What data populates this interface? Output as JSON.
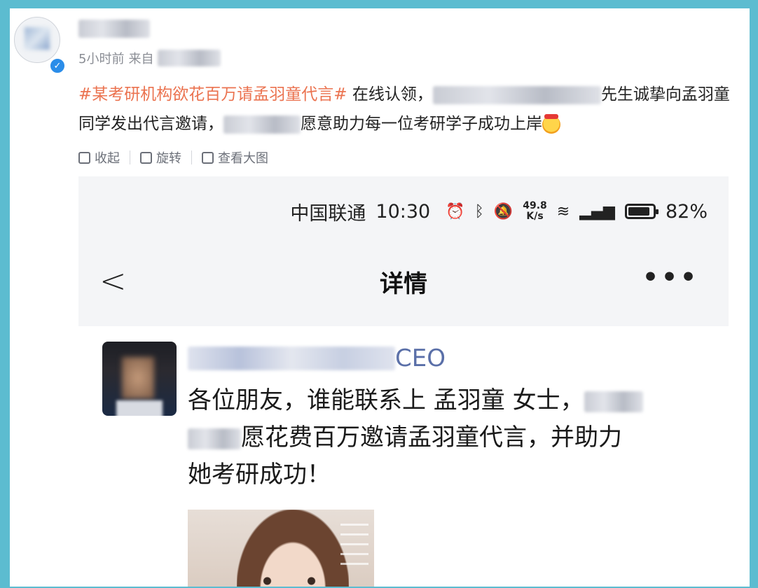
{
  "post": {
    "time": "5小时前",
    "source_prefix": "来自",
    "topic": "#某考研机构欲花百万请孟羽童代言#",
    "text_a": " 在线认领，",
    "text_b": "先生诚挚向孟羽童同学发出代言邀请，",
    "text_c": "愿意助力每一位考研学子成功上岸",
    "emoji_icon": "hugging-face-emoji"
  },
  "actions": {
    "collapse": "收起",
    "rotate": "旋转",
    "view_large": "查看大图"
  },
  "screenshot": {
    "carrier": "中国联通",
    "time": "10:30",
    "speed_value": "49.8",
    "speed_unit": "K/s",
    "battery": "82%",
    "nav_title": "详情",
    "author_suffix": "CEO",
    "message_line1": "各位朋友，谁能联系上 孟羽童 女士，",
    "message_line2": "愿花费百万邀请孟羽童代言，并助力",
    "message_line3": "她考研成功！"
  },
  "colors": {
    "topic": "#eb7350",
    "verified": "#2b8de9",
    "frame": "#5cbcd0"
  }
}
